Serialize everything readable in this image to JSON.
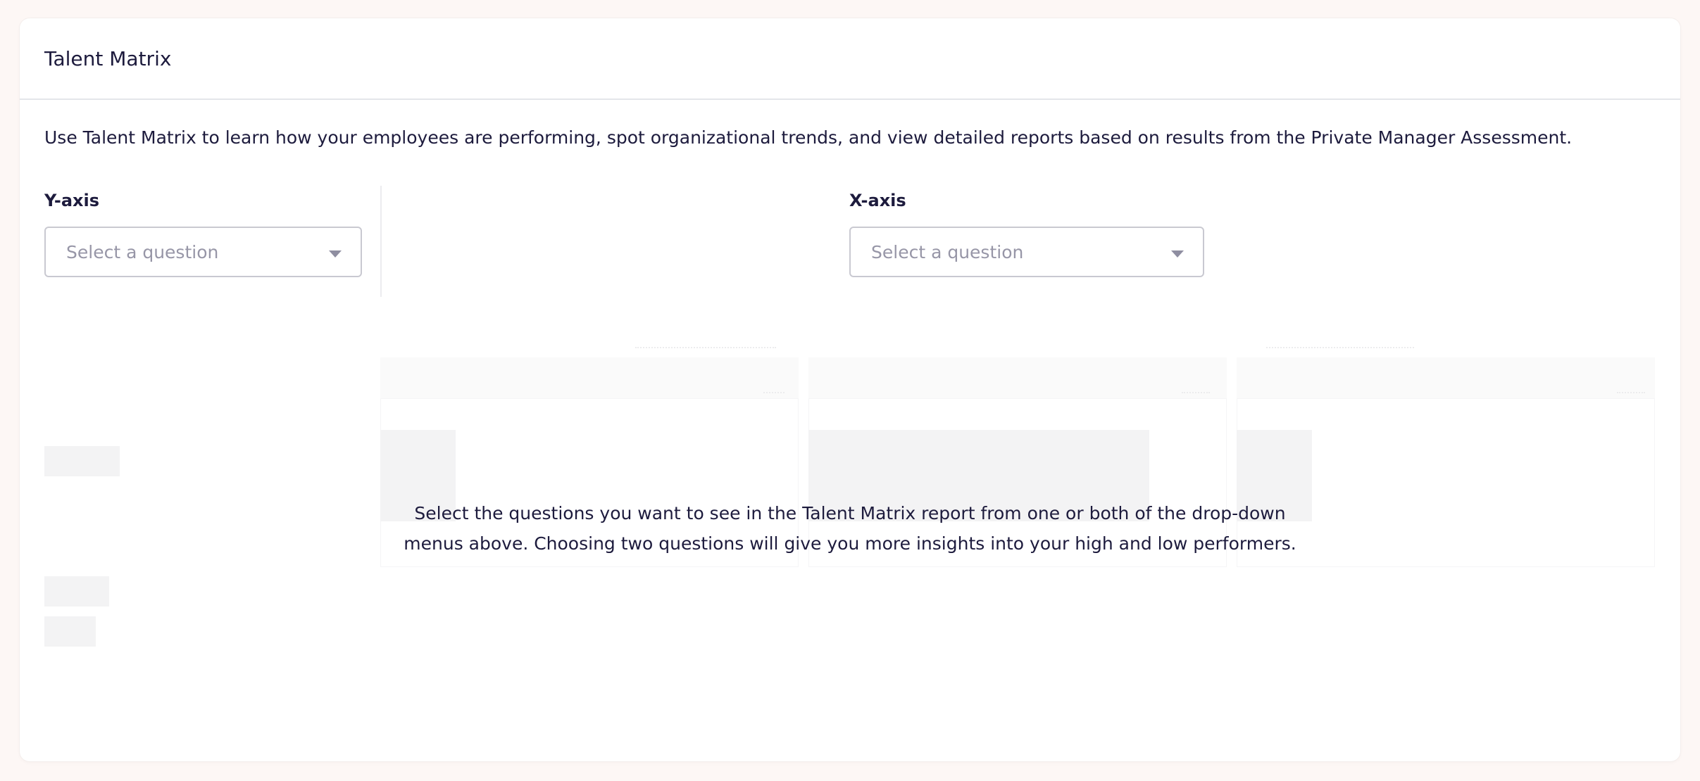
{
  "card": {
    "title": "Talent Matrix",
    "intro": "Use Talent Matrix to learn how your employees are performing, spot organizational trends, and view detailed reports based on results from the Private Manager Assessment."
  },
  "y_axis": {
    "label": "Y-axis",
    "select_placeholder": "Select a question"
  },
  "x_axis": {
    "label": "X-axis",
    "select_placeholder": "Select a question"
  },
  "empty_state": {
    "line1": "Select the questions you want to see in the Talent Matrix report from one or both of the drop-down",
    "line2": "menus above. Choosing two questions will give you more insights into your high and low performers."
  },
  "icons": {
    "dropdown": "chevron-down-icon"
  },
  "colors": {
    "text": "#1d1b3d",
    "placeholder": "#9796a7",
    "page_background": "#fdf7f5",
    "skeleton": "#f3f3f4"
  }
}
